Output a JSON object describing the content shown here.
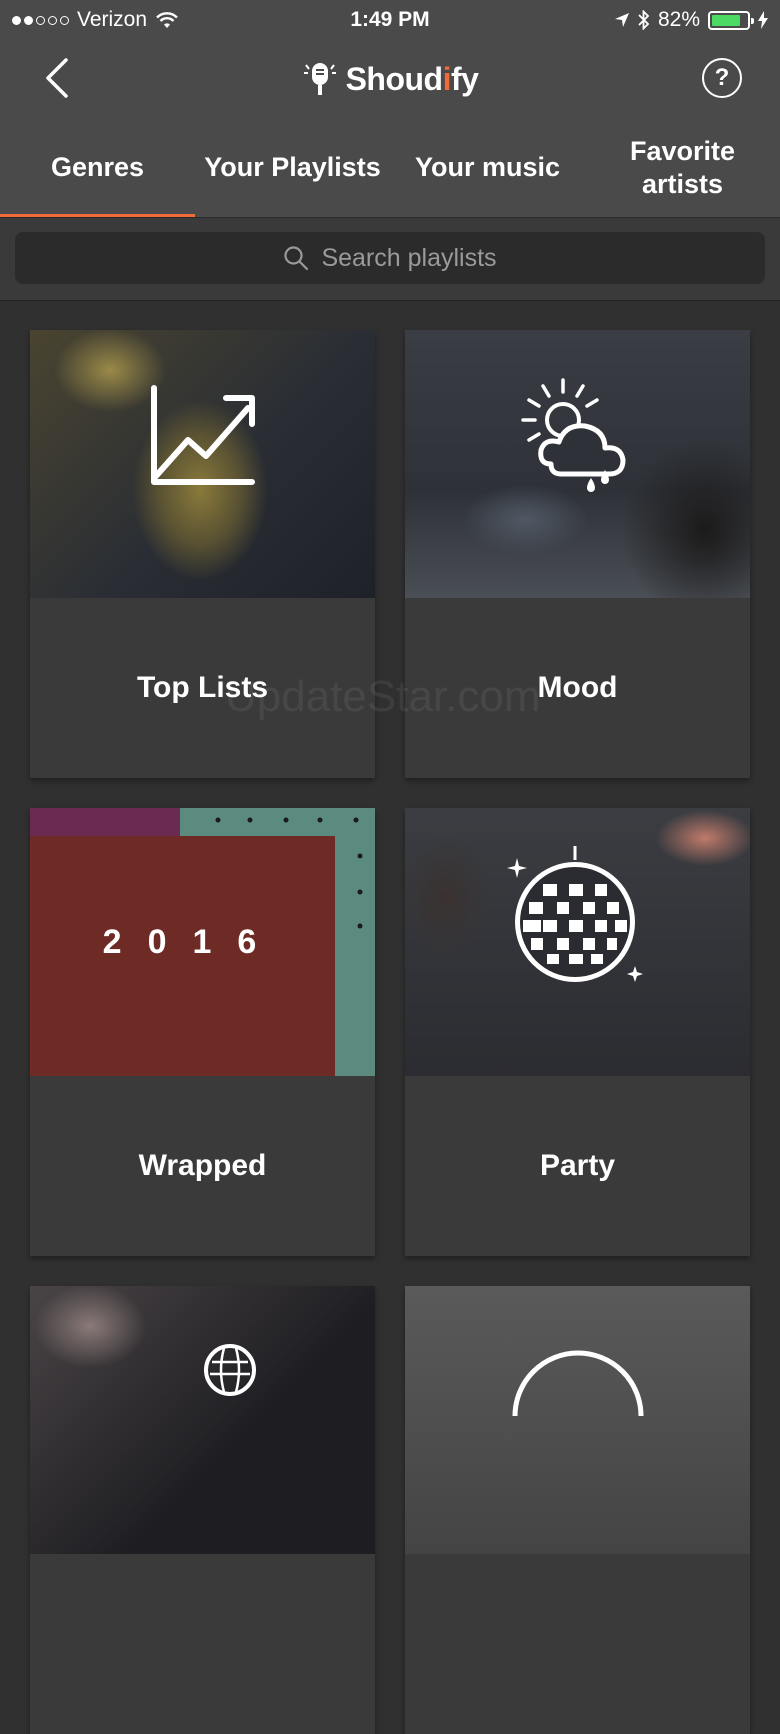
{
  "status_bar": {
    "carrier": "Verizon",
    "time": "1:49 PM",
    "battery": "82%",
    "battery_level": 0.82,
    "signal_bars_filled": 2,
    "signal_bars_total": 5
  },
  "nav": {
    "brand": {
      "part1": "Shoud",
      "part2": "i",
      "part3": "fy"
    },
    "help_glyph": "?"
  },
  "tabs": [
    {
      "label": "Genres",
      "active": true
    },
    {
      "label": "Your Playlists",
      "active": false
    },
    {
      "label": "Your music",
      "active": false
    },
    {
      "label": "Favorite artists",
      "active": false
    }
  ],
  "search": {
    "placeholder": "Search playlists"
  },
  "cards": [
    {
      "label": "Top Lists",
      "icon": "chart-trend-icon"
    },
    {
      "label": "Mood",
      "icon": "weather-icon"
    },
    {
      "label": "Wrapped",
      "image_text": "2016"
    },
    {
      "label": "Party",
      "icon": "disco-ball-icon"
    }
  ],
  "watermark": "UpdateStar.com",
  "colors": {
    "accent": "#ef6c3a",
    "background": "#303030",
    "bar": "#4a4a4a"
  }
}
